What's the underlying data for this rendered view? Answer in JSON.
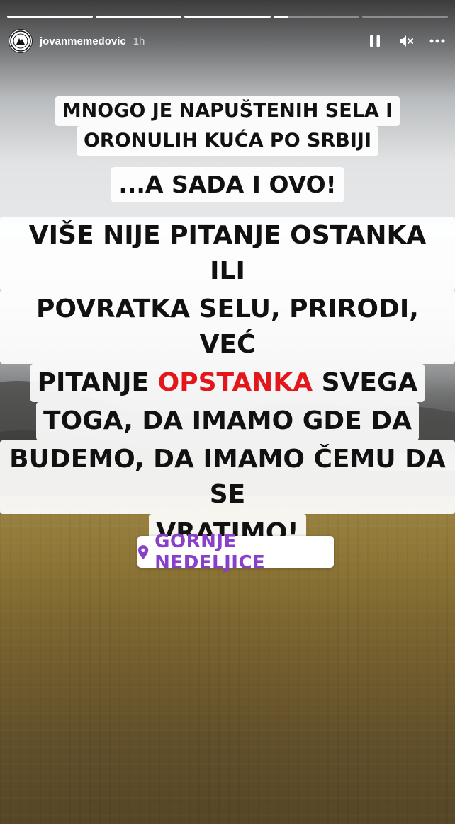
{
  "story": {
    "progress": [
      1,
      1,
      1,
      0.18,
      0
    ],
    "username": "jovanmemedovic",
    "time_ago": "1h",
    "icons": {
      "avatar": "logo-avatar",
      "pause": "pause-icon",
      "mute": "speaker-muted-icon",
      "more": "more-options-icon",
      "location": "location-pin-icon"
    }
  },
  "captions": {
    "intro_line1": "MNOGO JE NAPUŠTENIH SELA I",
    "intro_line2": "ORONULIH KUĆA PO SRBIJI",
    "emphasis": "...A SADA I OVO!",
    "body_line1": "VIŠE NIJE PITANJE OSTANKA ILI",
    "body_line2": "POVRATKA SELU, PRIRODI, VEĆ",
    "body_line3_pre": "PITANJE ",
    "body_line3_highlight": "OPSTANKA",
    "body_line3_post": " SVEGA",
    "body_line4": "TOGA, DA IMAMO GDE DA",
    "body_line5": "BUDEMO, DA IMAMO ČEMU DA SE",
    "body_line6": "VRATIMO!"
  },
  "location_sticker": {
    "label": "GORNJE NEDELJICE"
  },
  "colors": {
    "highlight_red": "#e3161b",
    "location_purple": "#8a3fc8"
  }
}
